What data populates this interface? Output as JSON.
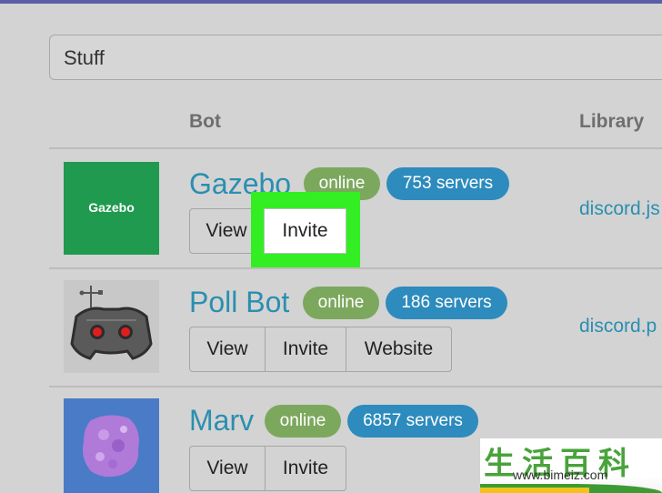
{
  "search": {
    "value": "Stuff"
  },
  "columns": {
    "bot": "Bot",
    "library": "Library"
  },
  "bots": [
    {
      "name": "Gazebo",
      "thumb_text": "Gazebo",
      "status": "online",
      "servers": "753 servers",
      "buttons": [
        "View",
        "Invite"
      ],
      "library": "discord.js"
    },
    {
      "name": "Poll Bot",
      "status": "online",
      "servers": "186 servers",
      "buttons": [
        "View",
        "Invite",
        "Website"
      ],
      "library": "discord.p"
    },
    {
      "name": "Marv",
      "status": "online",
      "servers": "6857 servers",
      "buttons": [
        "View",
        "Invite"
      ]
    }
  ],
  "watermark": {
    "chars": "生活百科",
    "url": "www.bimeiz.com"
  },
  "colors": {
    "accent_blue": "#2d8bbd",
    "online_green": "#7ca85d",
    "highlight": "#33ee22",
    "link": "#2a8fb0"
  }
}
